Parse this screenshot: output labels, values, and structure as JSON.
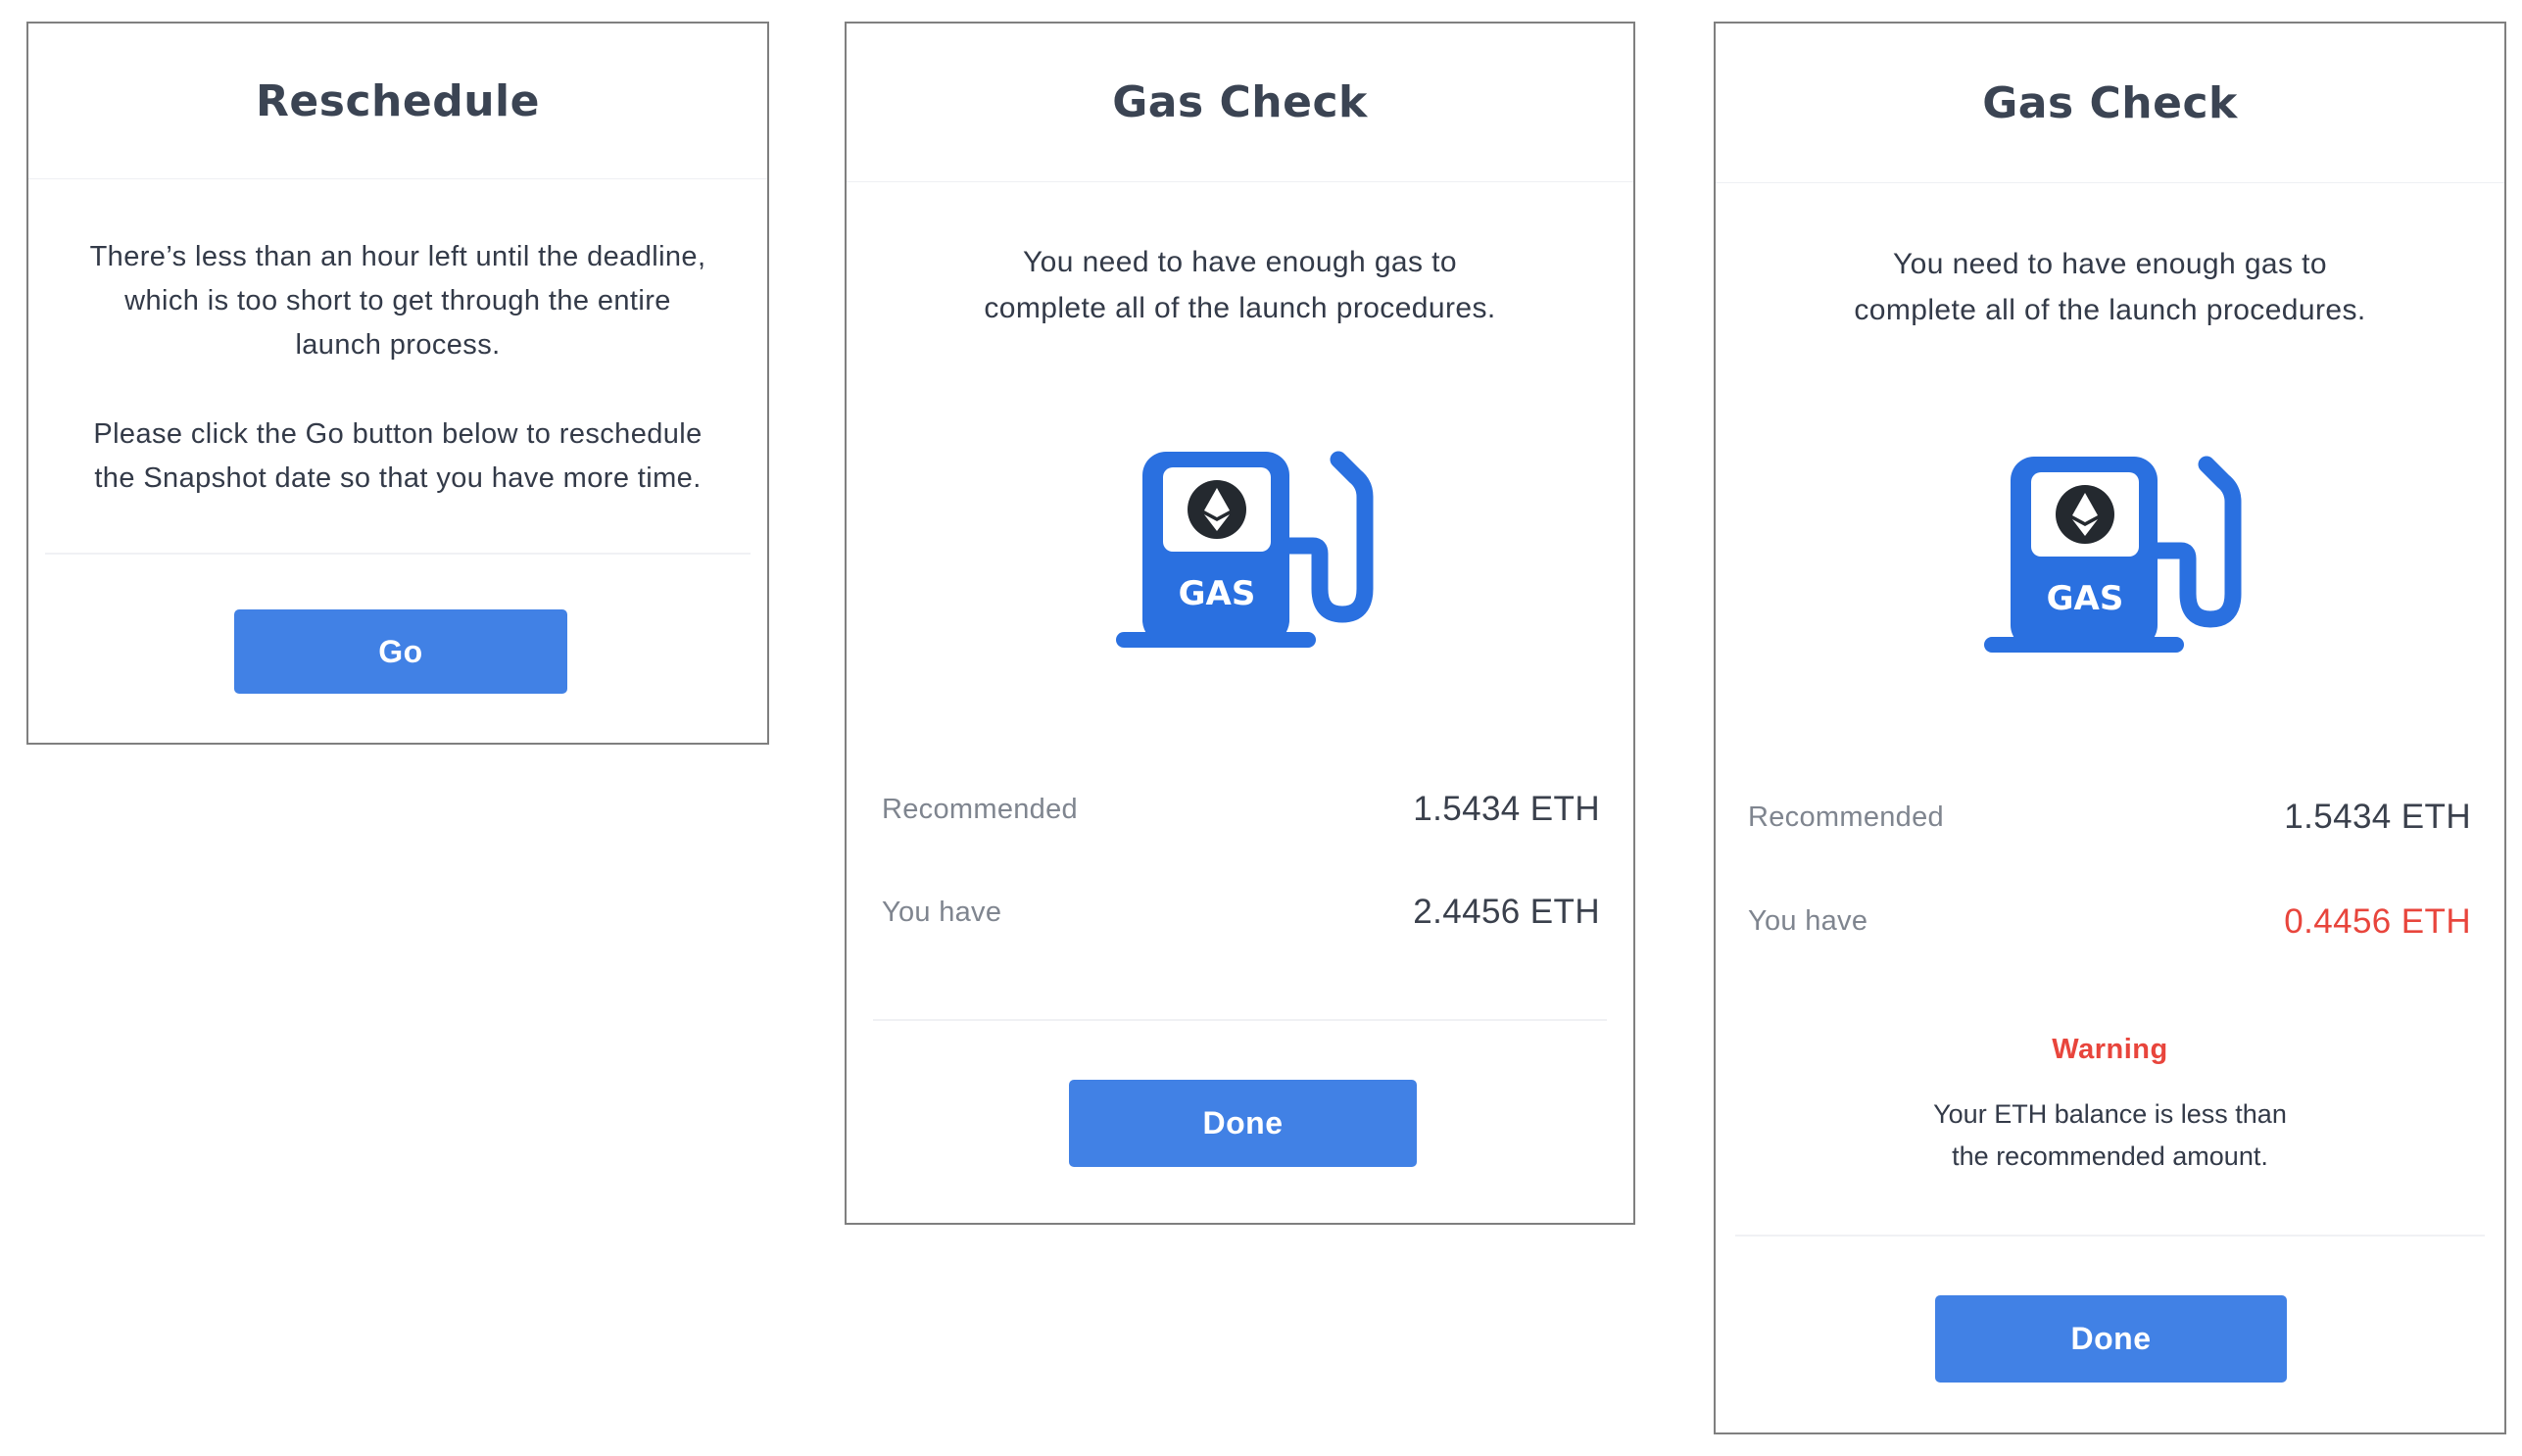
{
  "reschedule": {
    "title": "Reschedule",
    "paragraph_1": [
      "There’s less than an hour left until the deadline,",
      "which is too short to get through the entire",
      "launch process."
    ],
    "paragraph_2": [
      "Please click the Go button below to reschedule",
      "the Snapshot date so that you have more time."
    ],
    "go_label": "Go"
  },
  "gas_check_ok": {
    "title": "Gas Check",
    "description": [
      "You need to have enough gas to",
      "complete all of the launch procedures."
    ],
    "pump_label": "GAS",
    "recommended_label": "Recommended",
    "recommended_value": "1.5434 ETH",
    "have_label": "You have",
    "have_value": "2.4456 ETH",
    "done_label": "Done"
  },
  "gas_check_low": {
    "title": "Gas Check",
    "description": [
      "You need to have enough gas to",
      "complete all of the launch procedures."
    ],
    "pump_label": "GAS",
    "recommended_label": "Recommended",
    "recommended_value": "1.5434 ETH",
    "have_label": "You have",
    "have_value": "0.4456 ETH",
    "warning_title": "Warning",
    "warning_text": [
      "Your ETH balance is less than",
      "the recommended amount."
    ],
    "done_label": "Done"
  },
  "colors": {
    "accent": "#4181e5",
    "pump_blue": "#2a70e0",
    "warning_red": "#e8453c",
    "label_gray": "#7f858f",
    "title_dark": "#3b4453"
  },
  "icons": {
    "pump": "gas-pump-icon",
    "eth": "ethereum-icon"
  }
}
